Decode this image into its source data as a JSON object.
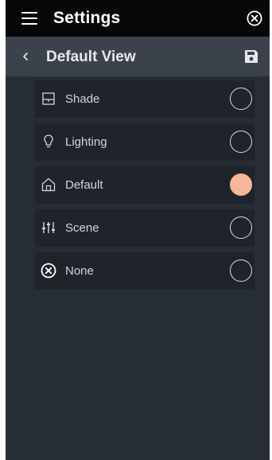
{
  "header": {
    "title": "Settings",
    "menu_icon": "hamburger-menu-icon",
    "close_icon": "close-circle-icon"
  },
  "subheader": {
    "title": "Default View",
    "back_icon": "chevron-left-icon",
    "save_icon": "save-floppy-icon"
  },
  "options": [
    {
      "label": "Shade",
      "icon": "shade-icon",
      "selected": false
    },
    {
      "label": "Lighting",
      "icon": "lightbulb-icon",
      "selected": false
    },
    {
      "label": "Default",
      "icon": "home-icon",
      "selected": true
    },
    {
      "label": "Scene",
      "icon": "sliders-icon",
      "selected": false
    },
    {
      "label": "None",
      "icon": "x-circle-icon",
      "selected": false
    }
  ],
  "colors": {
    "background": "#272d34",
    "topbar": "#060708",
    "subbar": "#3b424b",
    "row": "#1f242a",
    "accent_selected": "#f7b59a"
  }
}
